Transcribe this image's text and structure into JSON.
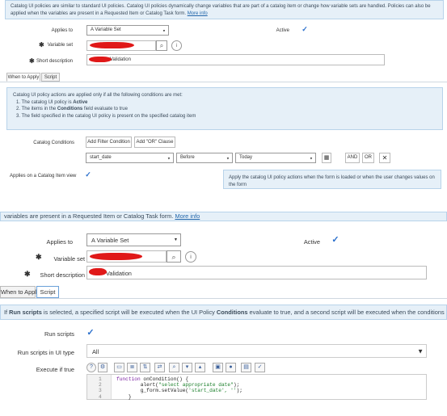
{
  "top": {
    "banner": {
      "text": "Catalog UI policies are similar to standard UI policies. Catalog UI policies dynamically change variables that are part of a catalog item or change how variable sets are handled. Policies can also be applied when the variables are present in a Requested Item or Catalog Task form.",
      "link": "More info"
    },
    "applies_to_label": "Applies to",
    "applies_to_value": "A Variable Set",
    "active_label": "Active",
    "variable_set_label": "Variable set",
    "short_description_label": "Short description",
    "short_description_suffix": "Validation",
    "tabs": [
      "When to Apply",
      "Script"
    ],
    "conditions_info": {
      "intro": "Catalog UI policy actions are applied only if all the following conditions are met:",
      "item1_pre": "1. The catalog UI policy is ",
      "item1_bold": "Active",
      "item2_pre": "2. The items in the ",
      "item2_bold": "Conditions",
      "item2_post": " field evaluate to true",
      "item3": "3. The field specified in the catalog UI policy is present on the specified catalog item"
    },
    "catalog_conditions_label": "Catalog Conditions",
    "add_filter_label": "Add Filter Condition",
    "add_or_label": "Add \"OR\" Clause",
    "condition_field": "start_date",
    "condition_operator": "Before",
    "condition_value": "Today",
    "and_label": "AND",
    "or_label": "OR",
    "applies_catalog_label": "Applies on a Catalog Item view",
    "tooltip_text": "Apply the catalog UI policy actions when the form is loaded or when the user changes values on the form"
  },
  "bottom": {
    "cut_text": "variables are present in a Requested Item or Catalog Task form.",
    "cut_link": "More info",
    "applies_to_label": "Applies to",
    "applies_to_value": "A Variable Set",
    "active_label": "Active",
    "variable_set_label": "Variable set",
    "short_description_label": "Short description",
    "short_description_suffix": "Validation",
    "tabs": [
      "When to Apply",
      "Script"
    ],
    "script_info": {
      "pre1": "If ",
      "bold1": "Run scripts",
      "mid1": " is selected, a specified script will be executed when the UI Policy ",
      "bold2": "Conditions",
      "post": " evaluate to true, and a second script will be executed when the conditions evaluate to false"
    },
    "run_scripts_label": "Run scripts",
    "run_scripts_ui_label": "Run scripts in UI type",
    "run_scripts_ui_value": "All",
    "execute_label": "Execute if true",
    "code": {
      "line_numbers": [
        "1",
        "2",
        "3",
        "4"
      ],
      "line1_kw": "function",
      "line1_rest": " onCondition() {",
      "line2_pre": "        alert(",
      "line2_str": "\"select appropriate date\"",
      "line2_post": ");",
      "line3_pre": "        g_form.setValue(",
      "line3_str": "'start_date', ''",
      "line3_post": ");",
      "line4": "    }"
    }
  },
  "colors": {
    "info_bg": "#e6f0f8",
    "redaction": "#e01818",
    "checkbox": "#2a6fcc"
  }
}
